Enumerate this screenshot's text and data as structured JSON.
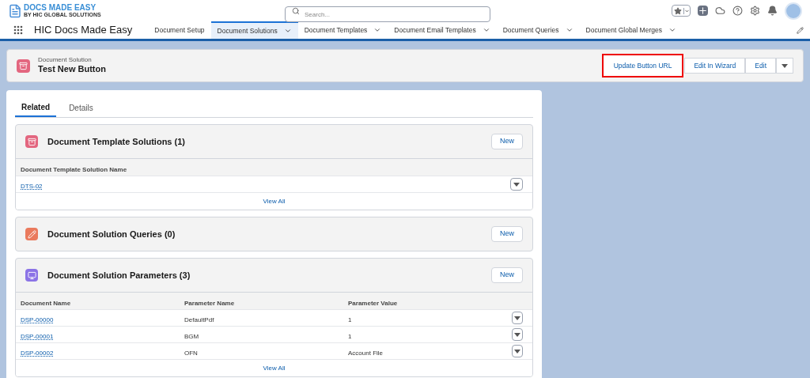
{
  "brand": {
    "title": "DOCS MADE EASY",
    "subtitle": "BY HIC GLOBAL SOLUTIONS"
  },
  "search": {
    "placeholder": "Search..."
  },
  "app_name": "HIC Docs Made Easy",
  "nav": [
    {
      "label": "Document Setup",
      "has_menu": false,
      "selected": false
    },
    {
      "label": "Document Solutions",
      "has_menu": true,
      "selected": true
    },
    {
      "label": "Document Templates",
      "has_menu": true,
      "selected": false
    },
    {
      "label": "Document Email Templates",
      "has_menu": true,
      "selected": false
    },
    {
      "label": "Document Queries",
      "has_menu": true,
      "selected": false
    },
    {
      "label": "Document Global Merges",
      "has_menu": true,
      "selected": false
    }
  ],
  "record": {
    "type": "Document Solution",
    "name": "Test New Button",
    "color": "#e3667f"
  },
  "actions": [
    {
      "label": "Update Button URL",
      "highlighted": true
    },
    {
      "label": "Edit In Wizard",
      "highlighted": false
    },
    {
      "label": "Edit",
      "highlighted": false
    }
  ],
  "tabs": [
    {
      "label": "Related",
      "selected": true
    },
    {
      "label": "Details",
      "selected": false
    }
  ],
  "sections": [
    {
      "title": "Document Template Solutions (1)",
      "color": "#e3667f",
      "button": "New",
      "columns": [
        "Document Template Solution Name"
      ],
      "rows": [
        [
          "DTS-02"
        ]
      ],
      "view_all": "View All"
    },
    {
      "title": "Document Solution Queries (0)",
      "color": "#ea7a5d",
      "button": "New"
    },
    {
      "title": "Document Solution Parameters (3)",
      "color": "#8b73e6",
      "button": "New",
      "columns": [
        "Document Name",
        "Parameter Name",
        "Parameter Value"
      ],
      "rows": [
        [
          "DSP-00000",
          "DefaultPdf",
          "1"
        ],
        [
          "DSP-00001",
          "BGM",
          "1"
        ],
        [
          "DSP-00002",
          "OFN",
          "Account File"
        ]
      ],
      "view_all": "View All"
    }
  ]
}
